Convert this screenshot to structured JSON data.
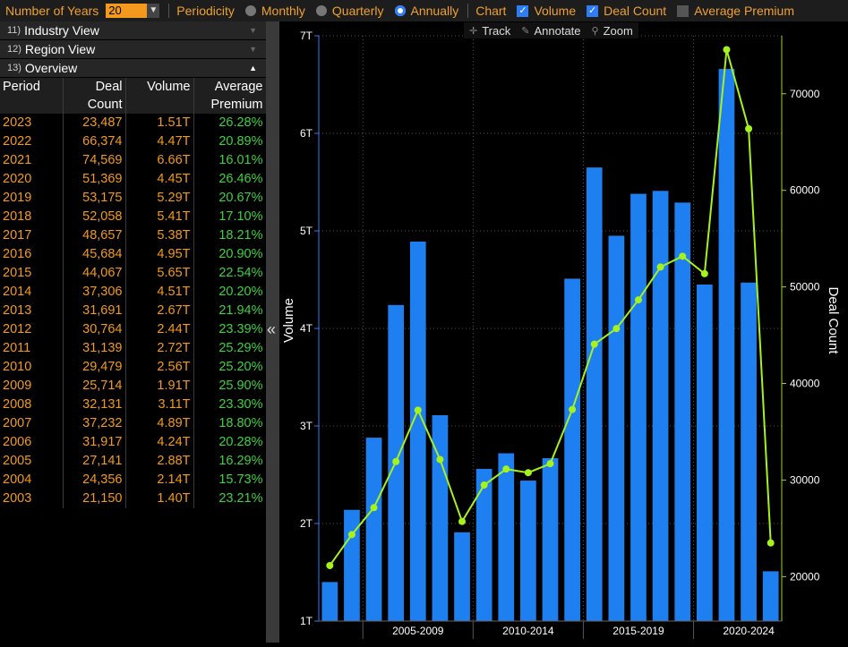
{
  "toolbar": {
    "years_label": "Number of Years",
    "years_value": "20",
    "periodicity_label": "Periodicity",
    "monthly": "Monthly",
    "quarterly": "Quarterly",
    "annually": "Annually",
    "periodicity_selected": "Annually",
    "chart_label": "Chart",
    "volume": "Volume",
    "volume_checked": true,
    "deal_count": "Deal Count",
    "deal_count_checked": true,
    "avg_premium": "Average Premium",
    "avg_premium_checked": false
  },
  "sections": [
    {
      "num": "11)",
      "label": "Industry View",
      "expanded": false
    },
    {
      "num": "12)",
      "label": "Region View",
      "expanded": false
    },
    {
      "num": "13)",
      "label": "Overview",
      "expanded": true
    }
  ],
  "table": {
    "headers": [
      "Period",
      "Deal\nCount",
      "Volume",
      "Average\nPremium"
    ],
    "rows": [
      [
        "2023",
        "23,487",
        "1.51T",
        "26.28%"
      ],
      [
        "2022",
        "66,374",
        "4.47T",
        "20.89%"
      ],
      [
        "2021",
        "74,569",
        "6.66T",
        "16.01%"
      ],
      [
        "2020",
        "51,369",
        "4.45T",
        "26.46%"
      ],
      [
        "2019",
        "53,175",
        "5.29T",
        "20.67%"
      ],
      [
        "2018",
        "52,058",
        "5.41T",
        "17.10%"
      ],
      [
        "2017",
        "48,657",
        "5.38T",
        "18.21%"
      ],
      [
        "2016",
        "45,684",
        "4.95T",
        "20.90%"
      ],
      [
        "2015",
        "44,067",
        "5.65T",
        "22.54%"
      ],
      [
        "2014",
        "37,306",
        "4.51T",
        "20.20%"
      ],
      [
        "2013",
        "31,691",
        "2.67T",
        "21.94%"
      ],
      [
        "2012",
        "30,764",
        "2.44T",
        "23.39%"
      ],
      [
        "2011",
        "31,139",
        "2.72T",
        "25.29%"
      ],
      [
        "2010",
        "29,479",
        "2.56T",
        "25.20%"
      ],
      [
        "2009",
        "25,714",
        "1.91T",
        "25.90%"
      ],
      [
        "2008",
        "32,131",
        "3.11T",
        "23.30%"
      ],
      [
        "2007",
        "37,232",
        "4.89T",
        "18.80%"
      ],
      [
        "2006",
        "31,917",
        "4.24T",
        "20.28%"
      ],
      [
        "2005",
        "27,141",
        "2.88T",
        "16.29%"
      ],
      [
        "2004",
        "24,356",
        "2.14T",
        "15.73%"
      ],
      [
        "2003",
        "21,150",
        "1.40T",
        "23.21%"
      ]
    ]
  },
  "chart_tools": {
    "track": "Track",
    "annotate": "Annotate",
    "zoom": "Zoom"
  },
  "colors": {
    "bar": "#1e7ff0",
    "line": "#a6f21c",
    "accent": "#f39a1e",
    "premium": "#3fd13f"
  },
  "chart_data": {
    "type": "bar",
    "x": [
      2003,
      2004,
      2005,
      2006,
      2007,
      2008,
      2009,
      2010,
      2011,
      2012,
      2013,
      2014,
      2015,
      2016,
      2017,
      2018,
      2019,
      2020,
      2021,
      2022,
      2023
    ],
    "series": [
      {
        "name": "Volume",
        "type": "bar",
        "axis": "left",
        "values": [
          1.4,
          2.14,
          2.88,
          4.24,
          4.89,
          3.11,
          1.91,
          2.56,
          2.72,
          2.44,
          2.67,
          4.51,
          5.65,
          4.95,
          5.38,
          5.41,
          5.29,
          4.45,
          6.66,
          4.47,
          1.51
        ]
      },
      {
        "name": "Deal Count",
        "type": "line",
        "axis": "right",
        "values": [
          21150,
          24356,
          27141,
          31917,
          37232,
          32131,
          25714,
          29479,
          31139,
          30764,
          31691,
          37306,
          44067,
          45684,
          48657,
          52058,
          53175,
          51369,
          74569,
          66374,
          23487
        ]
      }
    ],
    "ylabel": "Volume",
    "y2label": "Deal Count",
    "y_ticks": [
      "1T",
      "2T",
      "3T",
      "4T",
      "5T",
      "6T",
      "7T"
    ],
    "y2_ticks": [
      "20000",
      "30000",
      "40000",
      "50000",
      "60000",
      "70000"
    ],
    "x_ticks": [
      "2005-2009",
      "2010-2014",
      "2015-2019",
      "2020-2024"
    ],
    "ylim": [
      1,
      7
    ],
    "y2lim": [
      15400,
      76000
    ],
    "grid": true
  }
}
